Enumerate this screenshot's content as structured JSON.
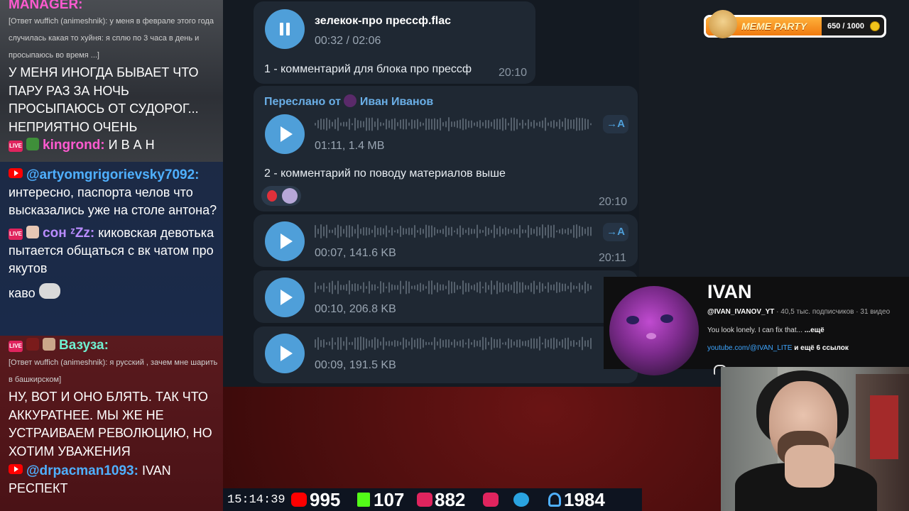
{
  "chat": {
    "messages": [
      {
        "user": "MANAGER:",
        "reply": "[Ответ wuffich (animeshnik): у меня в феврале этого года случилась какая то хуйня: я сплю по 3 часа в день и просыпаюсь во время ...]",
        "text": "У МЕНЯ ИНОГДА БЫВАЕТ ЧТО ПАРУ РАЗ ЗА НОЧЬ ПРОСЫПАЮСЬ ОТ СУДОРОГ... НЕПРИЯТНО ОЧЕНЬ"
      },
      {
        "user": "kingrond:",
        "text": "И В А Н"
      },
      {
        "user": "@artyomgrigorievsky7092:",
        "text": "интересно, паспорта челов что высказались уже на столе антона?"
      },
      {
        "user": "сон ᶻZz:",
        "text": "киковская девотька пытается общаться с вк чатом про якутов"
      },
      {
        "user": "",
        "text": "каво"
      },
      {
        "user": "Вазуза:",
        "reply": "[Ответ wuffich (animeshnik): я русский , зачем мне шарить в башкирском]",
        "text": "НУ, ВОТ И ОНО БЛЯТЬ. ТАК ЧТО АККУРАТНЕЕ. МЫ ЖЕ НЕ УСТРАИВАЕМ РЕВОЛЮЦИЮ, НО ХОТИМ УВАЖЕНИЯ"
      },
      {
        "user": "@drpacman1093:",
        "text": "IVAN РЕСПЕКТ"
      }
    ],
    "live_badge": "LIVE"
  },
  "telegram": {
    "audio1": {
      "title": "зелекок-про прессф.flac",
      "progress": "00:32 / 02:06",
      "caption": "1 - комментарий для блока про прессф",
      "time": "20:10"
    },
    "voice1": {
      "forwarded": "Переслано от",
      "forwarded_name": "Иван Иванов",
      "meta": "01:11, 1.4 MB",
      "caption": "2 - комментарий по поводу материалов выше",
      "time": "20:10",
      "transcribe": "→A"
    },
    "voice2": {
      "meta": "00:07, 141.6 KB",
      "time": "20:11",
      "transcribe": "→A"
    },
    "voice3": {
      "meta": "00:10, 206.8 KB"
    },
    "voice4": {
      "meta": "00:09, 191.5 KB"
    }
  },
  "channel": {
    "name": "IVAN",
    "handle": "@IVAN_IVANOV_YT",
    "stats": " · 40,5 тыс. подписчиков · 31 видео",
    "description": "You look lonely. I can fix that... ",
    "more": "...ещё",
    "link": "youtube.com/@IVAN_LITE",
    "links_more": " и ещё 6 ссылок"
  },
  "meme_party": {
    "label": "MEME PARTY",
    "count": "650 / 1000",
    "progress": 0.65
  },
  "stats_bar": {
    "clock": "15:14:39",
    "youtube": "995",
    "kick": "107",
    "vk": "882",
    "twitch_icon": "play-icon",
    "telegram_icon": "telegram-icon",
    "viewers": "1984"
  },
  "colors": {
    "accent": "#4f9fd9",
    "bubble": "#1f2833",
    "youtube": "#ff0000",
    "kick": "#53fc18",
    "vk": "#e0245e"
  }
}
